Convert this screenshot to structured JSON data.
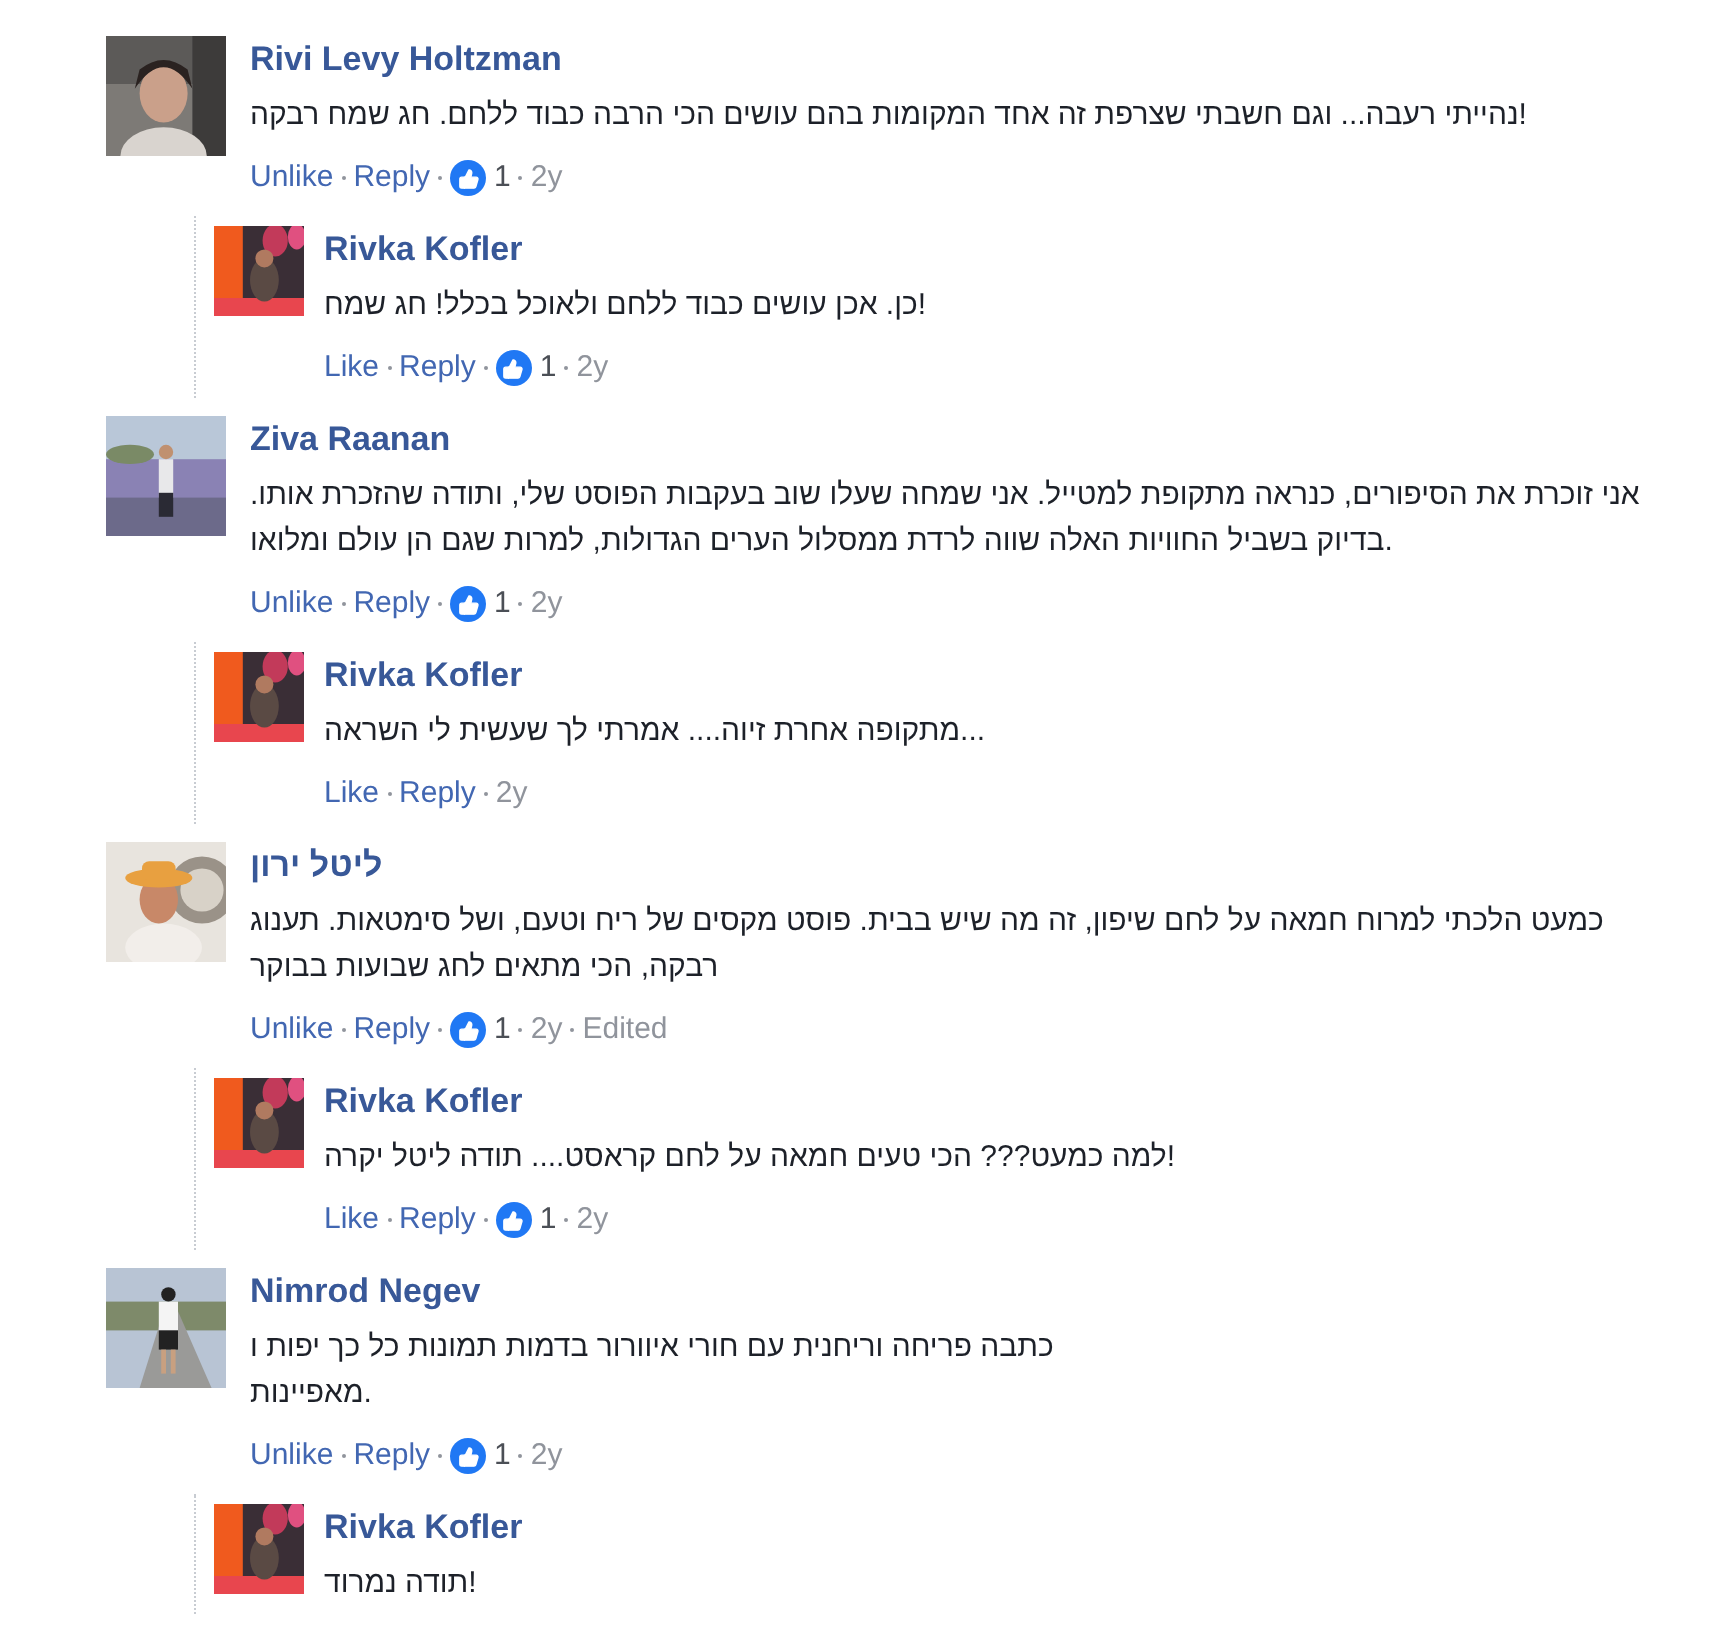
{
  "comments": [
    {
      "author": "Rivi Levy Holtzman",
      "text": "נהייתי רעבה... וגם חשבתי שצרפת זה אחד המקומות בהם עושים הכי הרבה כבוד ללחם. חג שמח רבקה!",
      "like_action": "Unlike",
      "reply_action": "Reply",
      "likes": "1",
      "age": "2y",
      "replies": [
        {
          "author": "Rivka Kofler",
          "text": "כן. אכן עושים כבוד ללחם ולאוכל בכלל! חג שמח!",
          "like_action": "Like",
          "reply_action": "Reply",
          "likes": "1",
          "age": "2y"
        }
      ]
    },
    {
      "author": "Ziva Raanan",
      "text": "אני זוכרת את הסיפורים, כנראה מתקופת למטייל. אני שמחה שעלו שוב בעקבות הפוסט שלי, ותודה שהזכרת אותו. בדיוק בשביל החוויות האלה שווה לרדת ממסלול הערים הגדולות, למרות שגם הן עולם ומלואו.",
      "like_action": "Unlike",
      "reply_action": "Reply",
      "likes": "1",
      "age": "2y",
      "replies": [
        {
          "author": "Rivka Kofler",
          "text": "מתקופה אחרת זיוה.... אמרתי לך שעשית לי השראה...",
          "like_action": "Like",
          "reply_action": "Reply",
          "age": "2y"
        }
      ]
    },
    {
      "author": "ליטל ירון",
      "text": "כמעט הלכתי למרוח חמאה על לחם שיפון, זה מה שיש בבית. פוסט מקסים של ריח וטעם, ושל סימטאות. תענוג רבקה, הכי מתאים לחג שבועות בבוקר",
      "like_action": "Unlike",
      "reply_action": "Reply",
      "likes": "1",
      "age": "2y",
      "edited": "Edited",
      "replies": [
        {
          "author": "Rivka Kofler",
          "text": "למה כמעט??? הכי טעים חמאה על לחם קראסט.... תודה ליטל יקרה!",
          "like_action": "Like",
          "reply_action": "Reply",
          "likes": "1",
          "age": "2y"
        }
      ]
    },
    {
      "author": "Nimrod Negev",
      "text": "כתבה פריחה וריחנית עם חורי איוורור בדמות תמונות כל כך יפות ו\nמאפיינות.",
      "like_action": "Unlike",
      "reply_action": "Reply",
      "likes": "1",
      "age": "2y",
      "replies": [
        {
          "author": "Rivka Kofler",
          "text": "תודה נמרוד!"
        }
      ]
    }
  ]
}
